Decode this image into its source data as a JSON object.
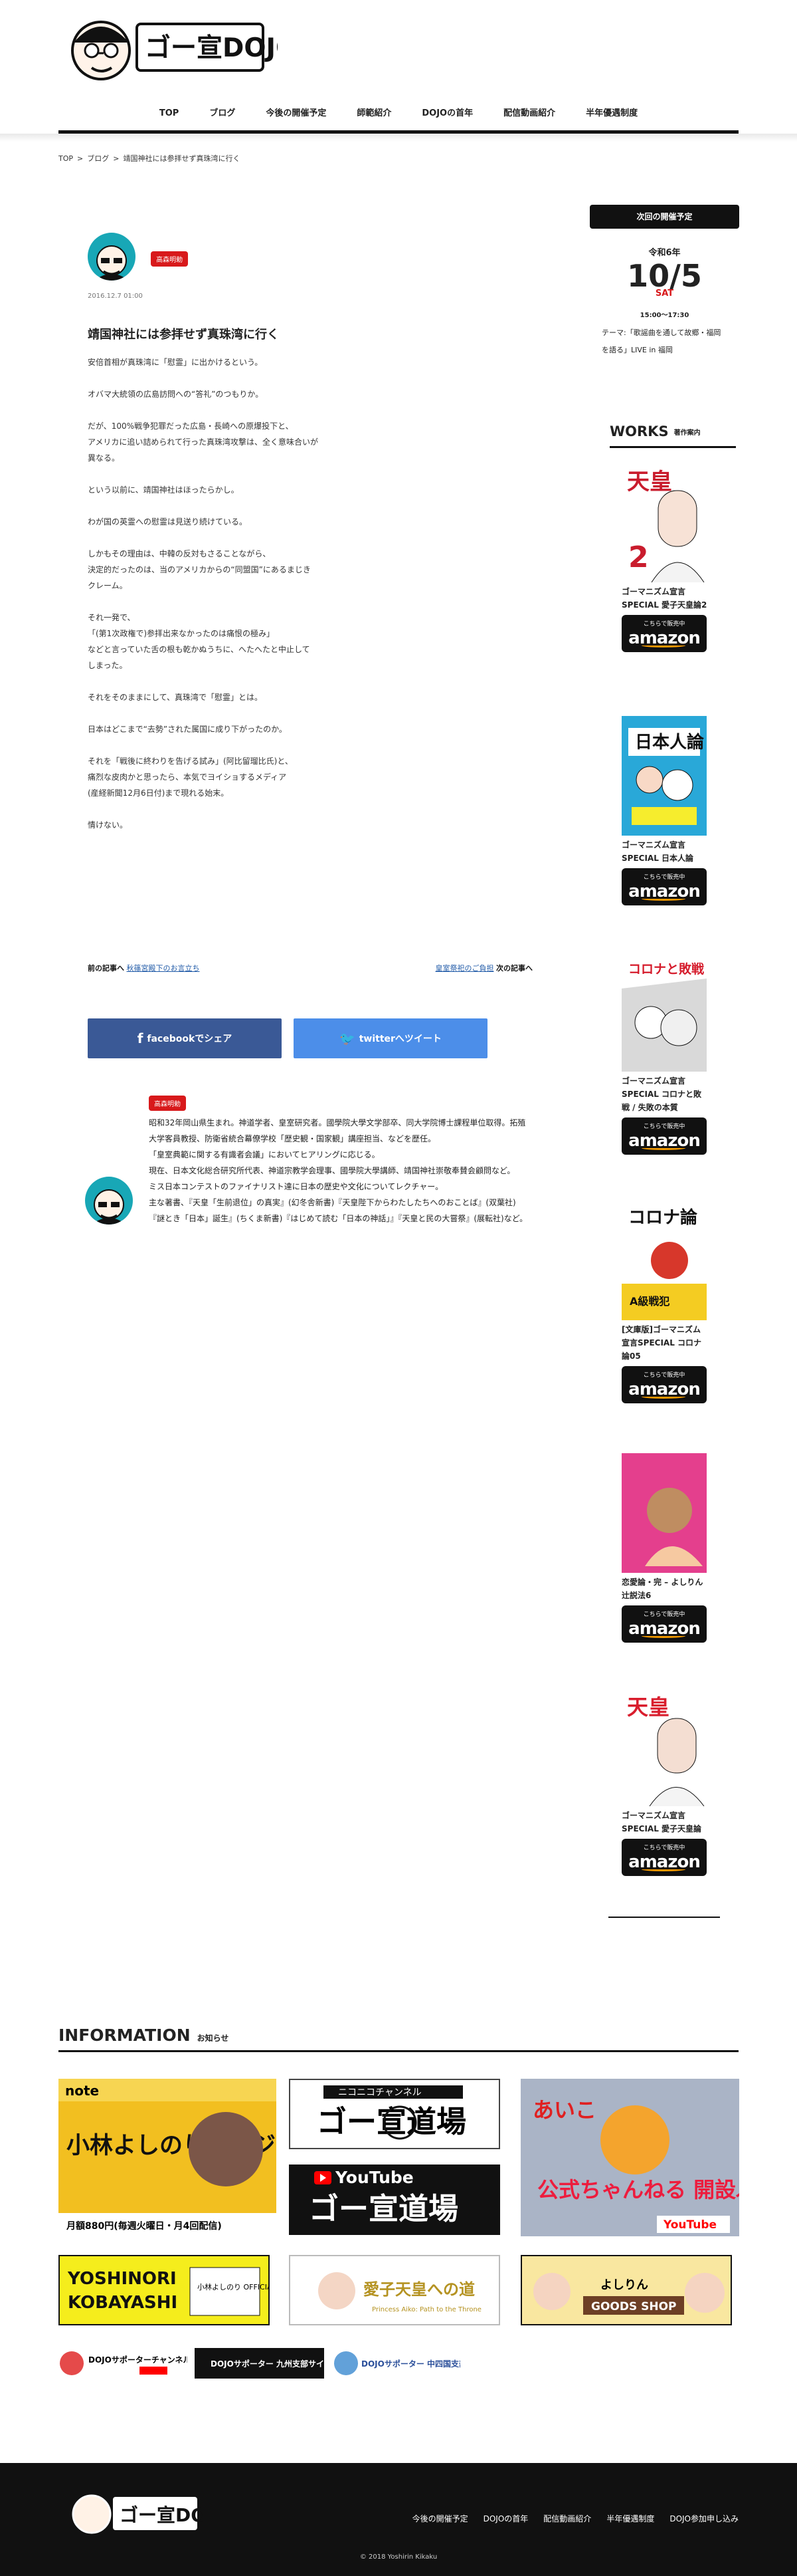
{
  "header": {
    "logo_text": "ゴー宣DOJO",
    "nav": [
      "TOP",
      "ブログ",
      "今後の開催予定",
      "師範紹介",
      "DOJOの首年",
      "配信動画紹介",
      "半年優遇制度"
    ]
  },
  "breadcrumb": {
    "items": [
      "TOP",
      ">",
      "ブログ",
      ">",
      "靖国神社には参拝せず真珠湾に行く"
    ]
  },
  "post": {
    "category": "高森明勅",
    "date": "2016.12.7 01:00",
    "title": "靖国神社には参拝せず真珠湾に行く",
    "paragraphs": [
      "安倍首相が真珠湾に「慰霊」に出かけるという。",
      "オバマ大統領の広島訪問への“答礼”のつもりか。",
      "だが、100%戦争犯罪だった広島・長崎への原爆投下と、\nアメリカに追い詰められて行った真珠湾攻撃は、全く意味合いが\n異なる。",
      "という以前に、靖国神社はほったらかし。",
      "わが国の英霊への慰霊は見送り続けている。",
      "しかもその理由は、中韓の反対もさることながら、\n決定的だったのは、当のアメリカからの“同盟国”にあるまじき\nクレーム。",
      "それ一発で、\n「(第1次政権で)参拝出来なかったのは痛恨の極み」\nなどと言っていた舌の根も乾かぬうちに、へたへたと中止して\nしまった。",
      "それをそのままにして、真珠湾で「慰霊」とは。",
      "日本はどこまで“去勢”された属国に成り下がったのか。",
      "それを「戦後に終わりを告げる試み」(阿比留瑠比氏)と、\n痛烈な皮肉かと思ったら、本気でヨイショするメディア\n(産経新聞12月6日付)まで現れる始末。",
      "情けない。"
    ]
  },
  "prev": {
    "label": "前の記事へ",
    "link": "秋篠宮殿下のお言立ち"
  },
  "next": {
    "link": "皇室祭祀のご負担",
    "label": "次の記事へ"
  },
  "share": {
    "facebook": "facebookでシェア",
    "twitter": "twitterへツイート"
  },
  "author": {
    "tag": "高森明勅",
    "bio": "昭和32年岡山県生まれ。神道学者、皇室研究者。國學院大學文学部卒、同大学院博士課程単位取得。拓殖大学客員教授、防衛省統合幕僚学校「歴史観・国家観」講座担当、などを歴任。\n「皇室典範に関する有識者会議」においてヒアリングに応じる。\n現在、日本文化総合研究所代表、神道宗教学会理事、國學院大學講師、靖国神社崇敬奉賛会顧問など。\nミス日本コンテストのファイナリスト達に日本の歴史や文化についてレクチャー。\n主な著書、『天皇「生前退位」の真実』(幻冬舎新書)『天皇陛下からわたしたちへのおことば』(双葉社)『謎とき「日本」誕生』(ちくま新書)『はじめて読む「日本の神話」』『天皇と民の大嘗祭』(展転社)など。"
  },
  "sidebar": {
    "heading": "次回の開催予定",
    "year": "令和6年",
    "md": "10/5",
    "day": "SAT",
    "time": "15:00〜17:30",
    "theme": "テーマ:「歌謡曲を通して故郷・福岡を語る」LIVE in 福岡"
  },
  "works": {
    "heading": "WORKS",
    "sub": "著作案内",
    "amazon_note": "こちらで販売中",
    "amazon": "amazon",
    "books": [
      "ゴーマニズム宣言SPECIAL 愛子天皇論2",
      "ゴーマニズム宣言SPECIAL 日本人論",
      "ゴーマニズム宣言SPECIAL コロナと敗戦 / 失敗の本質",
      "[文庫版]ゴーマニズム宣言SPECIAL コロナ論05",
      "恋愛論・完 – よしりん辻説法6",
      "ゴーマニズム宣言SPECIAL 愛子天皇論"
    ]
  },
  "information": {
    "heading": "INFORMATION",
    "sub": "お知らせ",
    "note_title": "小林よしのりライジング",
    "note_price": "月額880円(毎週火曜日・月4回配信)",
    "nico": "ニコニコチャンネル",
    "dojo": "ゴー宣道場",
    "youtube": "YouTube",
    "aiko": "あいこ",
    "oshirase": "公式ちゃんねる 開設ぶぁ〜い!",
    "yoshinori": "YOSHINORI KOBAYASHI",
    "official": "小林よしのり OFFICIAL WEB SITE!!",
    "aikoten": "愛子天皇への道",
    "aikoten_en": "Princess Aiko: Path to the Throne",
    "goods": "よしりん GOODS SHOP",
    "supporter1": "DOJOサポーターチャンネル",
    "supporter2": "DOJOサポーター 九州支部サイト",
    "supporter3": "DOJOサポーター 中四国支部ブログ"
  },
  "footer": {
    "nav": [
      "今後の開催予定",
      "DOJOの首年",
      "配信動画紹介",
      "半年優遇制度",
      "DOJO参加申し込み"
    ],
    "copyright": "© 2018 Yoshirin Kikaku"
  }
}
